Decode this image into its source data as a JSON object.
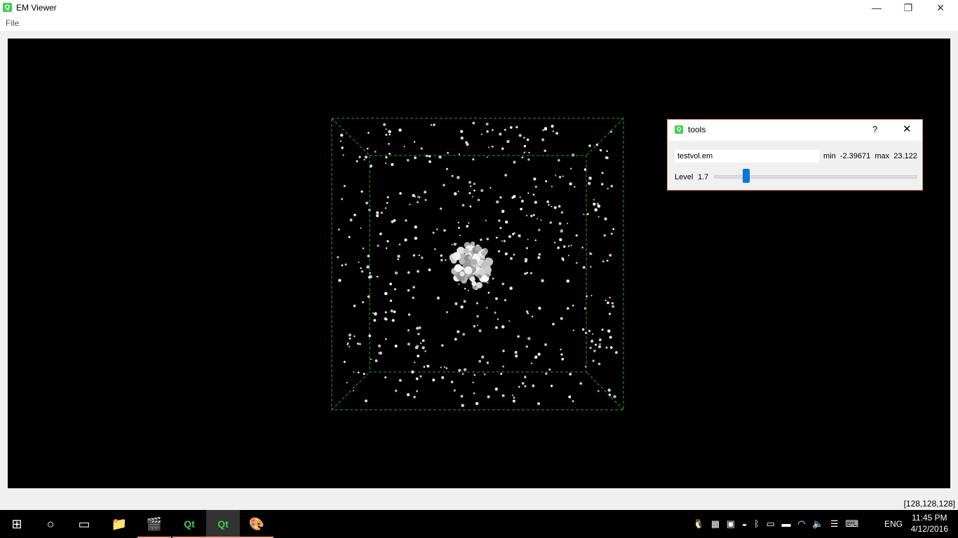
{
  "window": {
    "title": "EM Viewer",
    "minimize_glyph": "—",
    "restore_glyph": "❐",
    "close_glyph": "✕"
  },
  "menu": {
    "file_label": "File"
  },
  "viewport": {
    "background": "#000000",
    "box_color": "#22aa22"
  },
  "status": {
    "coords": "[128,128,128]"
  },
  "tools": {
    "title": "tools",
    "help": "?",
    "close": "✕",
    "filename": "testvol.em",
    "minmax": "min  -2.39671  max  23.122",
    "min_label": "min",
    "min_value": "-2.39671",
    "max_label": "max",
    "max_value": "23.122",
    "level_label": "Level",
    "level_value": "1.7",
    "level_fraction": 0.16,
    "accent": "#0078d7"
  },
  "taskbar": {
    "items": [
      {
        "name": "start-icon",
        "glyph": "⊞"
      },
      {
        "name": "cortana-icon",
        "glyph": "○"
      },
      {
        "name": "task-view-icon",
        "glyph": "▭"
      },
      {
        "name": "file-explorer-icon",
        "glyph": "📁"
      },
      {
        "name": "movie-maker-icon",
        "glyph": "🎬"
      },
      {
        "name": "qt-creator-icon",
        "glyph": "Qt"
      },
      {
        "name": "qt-app-icon",
        "glyph": "Qt"
      },
      {
        "name": "paint-icon",
        "glyph": "🎨"
      }
    ],
    "language": "ENG",
    "time": "11:45 PM",
    "date": "4/12/2016"
  }
}
